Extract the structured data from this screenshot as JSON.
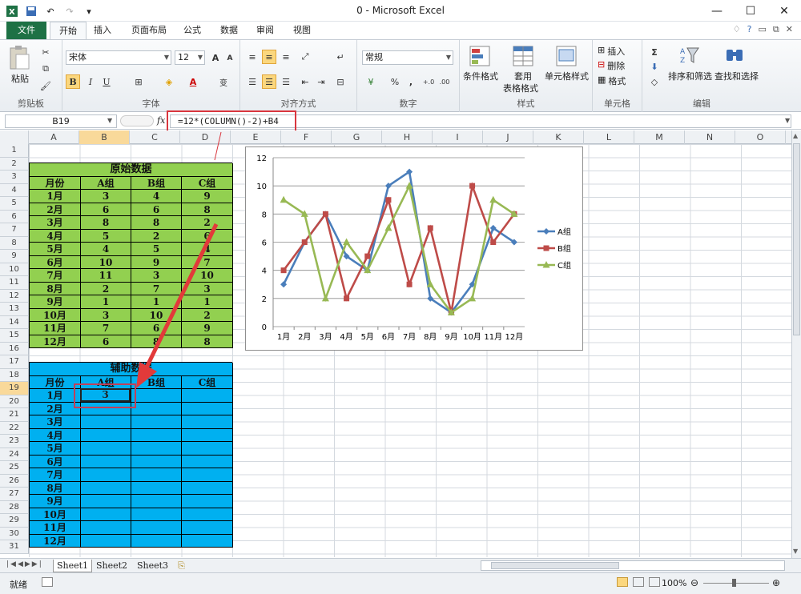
{
  "window": {
    "title": "0 - Microsoft Excel"
  },
  "tabs": [
    "文件",
    "开始",
    "插入",
    "页面布局",
    "公式",
    "数据",
    "审阅",
    "视图"
  ],
  "ribbon": {
    "clipboard": {
      "paste": "粘贴",
      "label": "剪贴板"
    },
    "font": {
      "name": "宋体",
      "size": "12",
      "label": "字体",
      "bold": "B",
      "italic": "I",
      "underline": "U",
      "grow": "A",
      "shrink": "A",
      "phonetic": "变",
      "fontcolor": "A"
    },
    "align": {
      "label": "对齐方式"
    },
    "number": {
      "format": "常规",
      "label": "数字",
      "percent": "%",
      "comma": ",",
      "inc": "+.0",
      "dec": ".00"
    },
    "styles": {
      "cond": "条件格式",
      "table1": "套用",
      "table2": "表格格式",
      "cell": "单元格样式",
      "label": "样式"
    },
    "cells": {
      "insert": "插入",
      "delete": "删除",
      "format": "格式",
      "label": "单元格"
    },
    "editing": {
      "sum": "Σ",
      "sort": "排序和筛选",
      "find": "查找和选择",
      "label": "编辑"
    }
  },
  "formula": {
    "namebox": "B19",
    "fx": "fx",
    "text": "=12*(COLUMN()-2)+B4"
  },
  "columns": [
    "A",
    "B",
    "C",
    "D",
    "E",
    "F",
    "G",
    "H",
    "I",
    "J",
    "K",
    "L",
    "M",
    "N",
    "O"
  ],
  "rows": [
    "1",
    "2",
    "3",
    "4",
    "5",
    "6",
    "7",
    "8",
    "9",
    "10",
    "11",
    "12",
    "13",
    "14",
    "15",
    "16",
    "17",
    "18",
    "19",
    "20",
    "21",
    "22",
    "23",
    "24",
    "25",
    "26",
    "27",
    "28",
    "29",
    "30",
    "31"
  ],
  "table1": {
    "title": "原始数据",
    "headers": [
      "月份",
      "A组",
      "B组",
      "C组"
    ],
    "rows": [
      [
        "1月",
        "3",
        "4",
        "9"
      ],
      [
        "2月",
        "6",
        "6",
        "8"
      ],
      [
        "3月",
        "8",
        "8",
        "2"
      ],
      [
        "4月",
        "5",
        "2",
        "6"
      ],
      [
        "5月",
        "4",
        "5",
        "4"
      ],
      [
        "6月",
        "10",
        "9",
        "7"
      ],
      [
        "7月",
        "11",
        "3",
        "10"
      ],
      [
        "8月",
        "2",
        "7",
        "3"
      ],
      [
        "9月",
        "1",
        "1",
        "1"
      ],
      [
        "10月",
        "3",
        "10",
        "2"
      ],
      [
        "11月",
        "7",
        "6",
        "9"
      ],
      [
        "12月",
        "6",
        "8",
        "8"
      ]
    ]
  },
  "table2": {
    "title": "辅助数据",
    "headers": [
      "月份",
      "A组",
      "B组",
      "C组"
    ],
    "months": [
      "1月",
      "2月",
      "3月",
      "4月",
      "5月",
      "6月",
      "7月",
      "8月",
      "9月",
      "10月",
      "11月",
      "12月"
    ],
    "b19": "3"
  },
  "chart_data": {
    "type": "line",
    "categories": [
      "1月",
      "2月",
      "3月",
      "4月",
      "5月",
      "6月",
      "7月",
      "8月",
      "9月",
      "10月",
      "11月",
      "12月"
    ],
    "ylim": [
      0,
      12
    ],
    "yticks": [
      "0",
      "2",
      "4",
      "6",
      "8",
      "10",
      "12"
    ],
    "grid": true,
    "legend": "right",
    "series": [
      {
        "name": "A组",
        "color": "#4a7ebb",
        "marker": "diamond",
        "values": [
          3,
          6,
          8,
          5,
          4,
          10,
          11,
          2,
          1,
          3,
          7,
          6
        ]
      },
      {
        "name": "B组",
        "color": "#be4b48",
        "marker": "square",
        "values": [
          4,
          6,
          8,
          2,
          5,
          9,
          3,
          7,
          1,
          10,
          6,
          8
        ]
      },
      {
        "name": "C组",
        "color": "#98b954",
        "marker": "triangle",
        "values": [
          9,
          8,
          2,
          6,
          4,
          7,
          10,
          3,
          1,
          2,
          9,
          8
        ]
      }
    ]
  },
  "sheets": [
    "Sheet1",
    "Sheet2",
    "Sheet3"
  ],
  "status": {
    "ready": "就绪",
    "zoom": "100%"
  },
  "colors": {
    "green": "#92d050",
    "blue": "#00b0f0",
    "excel": "#1e7145",
    "highlight": "#d9363e"
  }
}
